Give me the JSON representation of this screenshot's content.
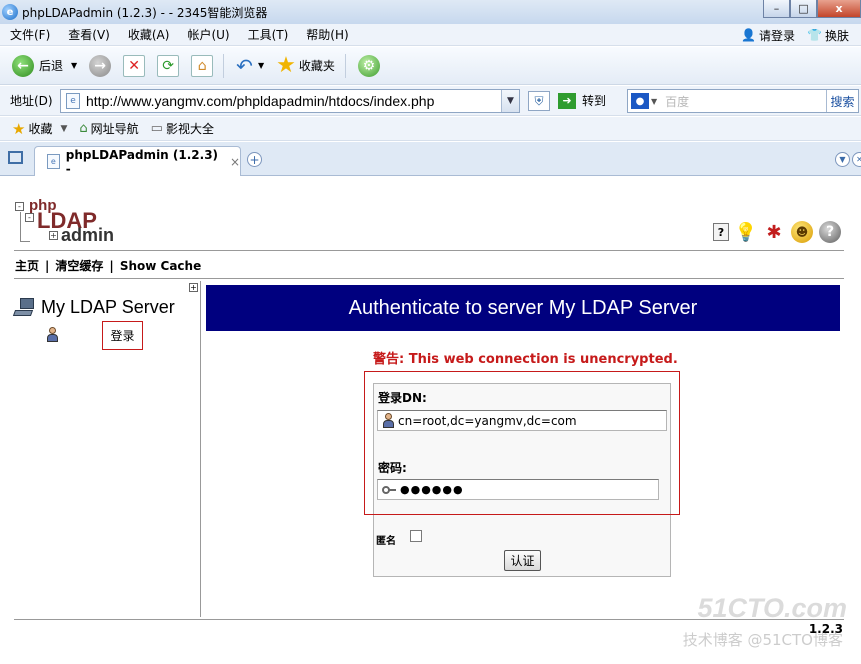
{
  "window": {
    "title": "phpLDAPadmin (1.2.3) - - 2345智能浏览器",
    "minimize_glyph": "–",
    "maximize_glyph": "□",
    "close_glyph": "x"
  },
  "menu": {
    "items": [
      "文件(F)",
      "查看(V)",
      "收藏(A)",
      "帐户(U)",
      "工具(T)",
      "帮助(H)"
    ],
    "login": "请登录",
    "skin": "换肤"
  },
  "toolbar": {
    "back_label": "后退",
    "favorites_label": "收藏夹"
  },
  "address": {
    "label": "地址(D)",
    "url": "http://www.yangmv.com/phpldapadmin/htdocs/index.php",
    "go_label": "转到",
    "search_placeholder": "百度",
    "search_button": "搜索"
  },
  "favbar": {
    "items": [
      "收藏",
      "网址导航",
      "影视大全"
    ]
  },
  "tabs": {
    "active_title": "phpLDAPadmin (1.2.3) -",
    "close_glyph": "×",
    "new_tab_glyph": "+"
  },
  "app": {
    "logo": {
      "php": "php",
      "ldap": "LDAP",
      "admin": "admin"
    },
    "nav": {
      "home": "主页",
      "clear_cache": "清空缓存",
      "show_cache": "Show Cache",
      "separator": "|"
    },
    "server_name": "My LDAP Server",
    "login_link": "登录",
    "auth_heading": "Authenticate to server My LDAP Server",
    "warning": "警告: This web connection is unencrypted.",
    "form": {
      "dn_label": "登录DN:",
      "dn_value": "cn=root,dc=yangmv,dc=com",
      "password_label": "密码:",
      "password_value": "●●●●●●",
      "anonymous_label": "匿名",
      "submit_label": "认证"
    },
    "version": "1.2.3"
  },
  "watermark": {
    "line1": "51CTO.com",
    "line2": "技术博客 @51CTO博客"
  },
  "colors": {
    "auth_header_bg": "#00007f",
    "warning": "#c61a1a",
    "logo_red": "#7f2a2a"
  }
}
